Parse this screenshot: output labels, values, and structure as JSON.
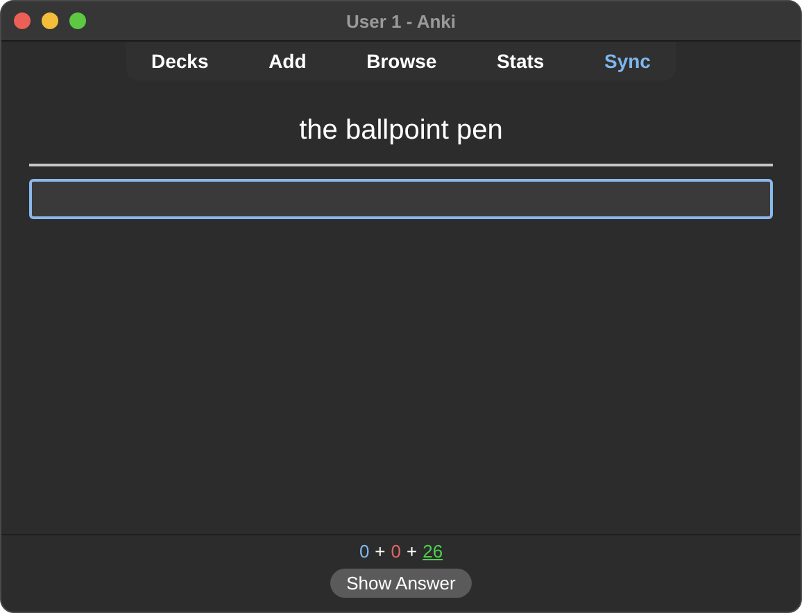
{
  "window": {
    "title": "User 1 - Anki"
  },
  "toolbar": [
    {
      "label": "Decks",
      "selected": false
    },
    {
      "label": "Add",
      "selected": false
    },
    {
      "label": "Browse",
      "selected": false
    },
    {
      "label": "Stats",
      "selected": false
    },
    {
      "label": "Sync",
      "selected": true
    }
  ],
  "card": {
    "question": "the ballpoint pen",
    "answer_field": {
      "focused": true
    }
  },
  "counts": [
    {
      "value": "0",
      "color": "#7fb6ee",
      "current": false
    },
    {
      "value": "0",
      "color": "#e06666",
      "current": false
    },
    {
      "value": "26",
      "color": "#4fcf4f",
      "current": true
    }
  ],
  "separators": [
    "+",
    "+"
  ],
  "show_answer_button": "Show Answer"
}
